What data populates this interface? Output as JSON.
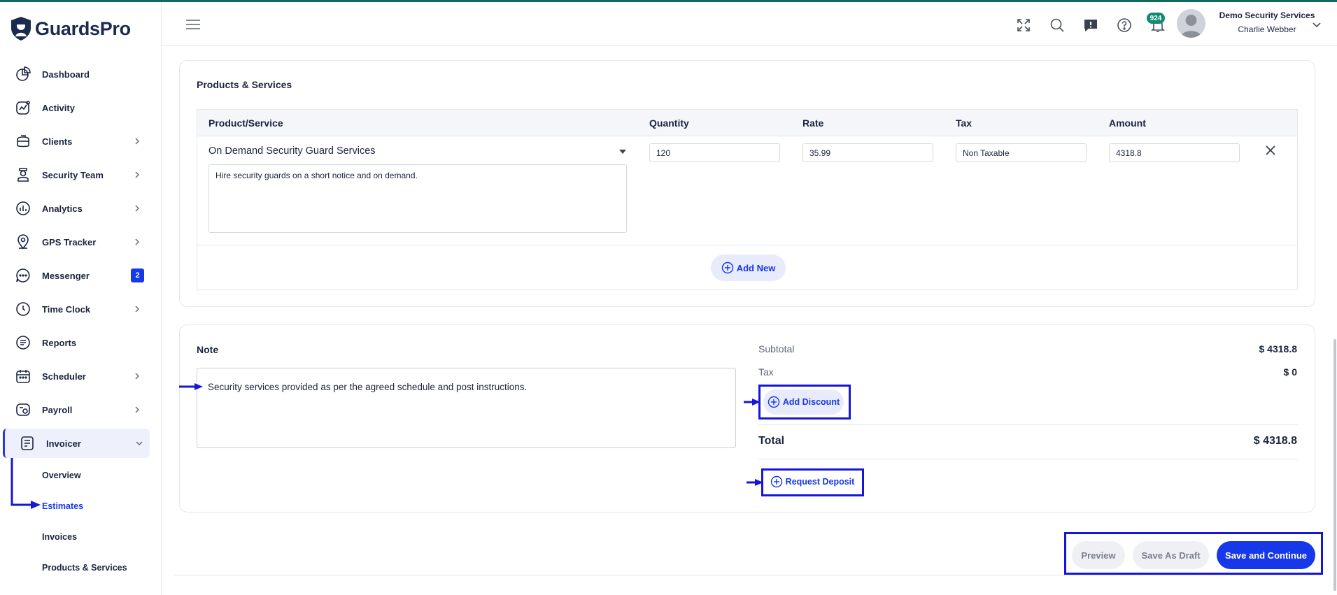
{
  "app": {
    "brand": "GuardsPro"
  },
  "sidebar": {
    "items": [
      {
        "label": "Dashboard",
        "icon": "dashboard-icon",
        "has_chevron": false
      },
      {
        "label": "Activity",
        "icon": "activity-icon",
        "has_chevron": false
      },
      {
        "label": "Clients",
        "icon": "clients-icon",
        "has_chevron": true
      },
      {
        "label": "Security Team",
        "icon": "security-team-icon",
        "has_chevron": true
      },
      {
        "label": "Analytics",
        "icon": "analytics-icon",
        "has_chevron": true
      },
      {
        "label": "GPS Tracker",
        "icon": "gps-icon",
        "has_chevron": true
      },
      {
        "label": "Messenger",
        "icon": "messenger-icon",
        "badge": "2"
      },
      {
        "label": "Time Clock",
        "icon": "time-clock-icon",
        "has_chevron": true
      },
      {
        "label": "Reports",
        "icon": "reports-icon",
        "has_chevron": false
      },
      {
        "label": "Scheduler",
        "icon": "scheduler-icon",
        "has_chevron": true
      },
      {
        "label": "Payroll",
        "icon": "payroll-icon",
        "has_chevron": true
      },
      {
        "label": "Invoicer",
        "icon": "invoicer-icon",
        "expanded": true,
        "active": true
      }
    ],
    "subitems": [
      {
        "label": "Overview"
      },
      {
        "label": "Estimates",
        "current": true
      },
      {
        "label": "Invoices"
      },
      {
        "label": "Products & Services"
      }
    ]
  },
  "header": {
    "notification_count": "924",
    "company": "Demo Security Services",
    "user": "Charlie Webber"
  },
  "products": {
    "title": "Products & Services",
    "columns": [
      "Product/Service",
      "Quantity",
      "Rate",
      "Tax",
      "Amount"
    ],
    "row": {
      "service": "On Demand Security Guard Services",
      "description": "Hire security guards on a short notice and on demand.",
      "quantity": "120",
      "rate": "35.99",
      "tax": "Non Taxable",
      "amount": "4318.8"
    },
    "add_new_label": "Add New"
  },
  "note": {
    "title": "Note",
    "text": "Security services provided as per the agreed schedule and post instructions."
  },
  "summary": {
    "subtotal_label": "Subtotal",
    "subtotal_value": "$ 4318.8",
    "tax_label": "Tax",
    "tax_value": "$ 0",
    "add_discount_label": "Add Discount",
    "total_label": "Total",
    "total_value": "$ 4318.8",
    "request_deposit_label": "Request Deposit"
  },
  "actions": {
    "preview": "Preview",
    "save_draft": "Save As Draft",
    "save_continue": "Save and Continue"
  },
  "colors": {
    "accent": "#1638e8",
    "brand": "#1c2a4f",
    "annotation": "#1616d8",
    "badge": "#0f8a73"
  }
}
